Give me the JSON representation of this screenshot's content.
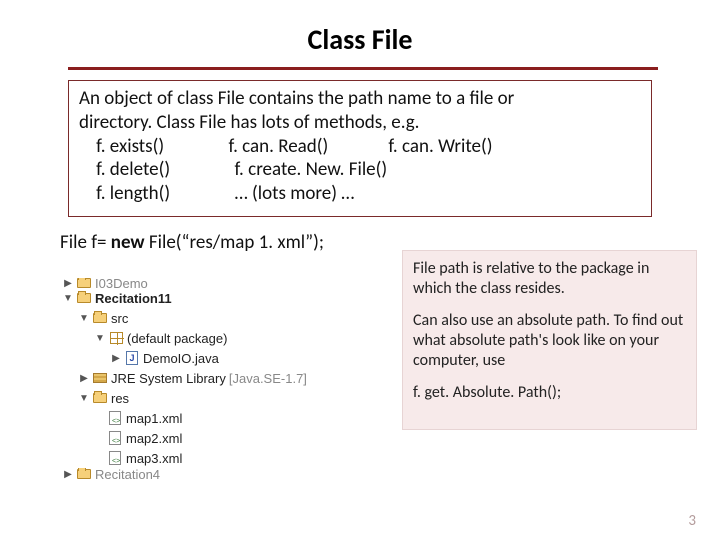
{
  "title": "Class File",
  "desc": {
    "l1": "An object of class File contains the path name to a file or",
    "l2": "directory. Class File has lots of methods, e.g.",
    "l3": "    f. exists()               f. can. Read()              f. can. Write()",
    "l4": "    f. delete()               f. create. New. File()",
    "l5": "    f. length()               … (lots more) …"
  },
  "code": {
    "pre": "File f= ",
    "kw": "new",
    "post": " File(“res/map 1. xml”);"
  },
  "tree": {
    "n0": "I03Demo",
    "n1": "Recitation11",
    "n2": "src",
    "n3": "(default package)",
    "n4": "DemoIO.java",
    "n5": "JRE System Library",
    "n5suffix": " [Java.SE-1.7]",
    "n6": "res",
    "n7": "map1.xml",
    "n8": "map2.xml",
    "n9": "map3.xml",
    "n10": "Recitation4"
  },
  "note": {
    "p1": "File path is relative to the package in which the class resides.",
    "p2": "Can also use an absolute path. To find out what absolute path's look like on your computer, use",
    "p3": "f. get. Absolute. Path();"
  },
  "page": "3"
}
